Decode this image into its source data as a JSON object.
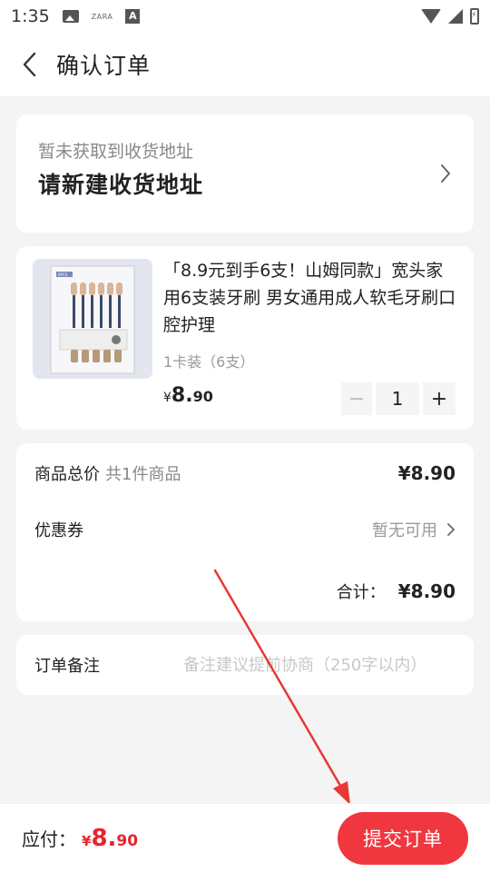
{
  "status_bar": {
    "time": "1:35",
    "brand": "ZARA",
    "a_badge": "A",
    "icons": [
      "image-icon",
      "zara-icon",
      "a-icon",
      "wifi-icon",
      "cellular-icon",
      "battery-charging-icon"
    ]
  },
  "header": {
    "back_icon": "chevron-left-icon",
    "title": "确认订单"
  },
  "address": {
    "hint": "暂未获取到收货地址",
    "main": "请新建收货地址",
    "icon": "chevron-right-icon"
  },
  "product": {
    "title": "「8.9元到手6支！山姆同款」宽头家用6支装牙刷 男女通用成人软毛牙刷口腔护理",
    "spec": "1卡装（6支）",
    "price_currency": "¥",
    "price_int": "8.",
    "price_dec": "90",
    "quantity": "1",
    "minus": "−",
    "plus": "+",
    "thumb_pack_label": "6PCS"
  },
  "summary": {
    "total_label": "商品总价",
    "total_sub": "共1件商品",
    "total_amount": "¥8.90",
    "coupon_label": "优惠券",
    "coupon_value": "暂无可用",
    "sum_label": "合计：",
    "sum_amount": "¥8.90"
  },
  "remark": {
    "label": "订单备注",
    "placeholder": "备注建议提前协商（250字以内）"
  },
  "bottom": {
    "pay_label": "应付：",
    "pay_currency": "¥",
    "pay_int": "8.",
    "pay_dec": "90",
    "submit": "提交订单"
  },
  "colors": {
    "accent": "#f0373f",
    "price_red": "#e8242b",
    "arrow_red": "#e53935"
  }
}
